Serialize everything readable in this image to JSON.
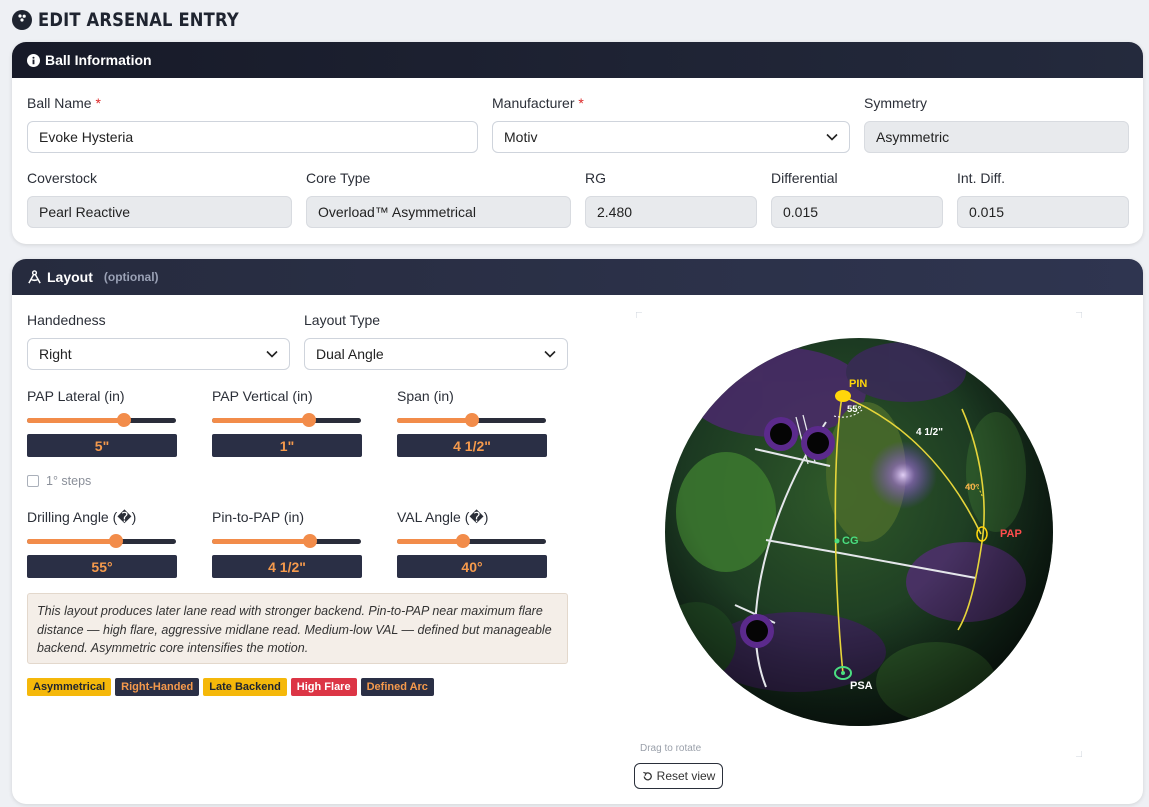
{
  "page": {
    "title": "EDIT ARSENAL ENTRY"
  },
  "ball_info": {
    "heading": "Ball Information",
    "ball_name": {
      "label": "Ball Name",
      "required_mark": "*",
      "value": "Evoke Hysteria"
    },
    "manufacturer": {
      "label": "Manufacturer",
      "required_mark": "*",
      "value": "Motiv"
    },
    "symmetry": {
      "label": "Symmetry",
      "value": "Asymmetric"
    },
    "coverstock": {
      "label": "Coverstock",
      "value": "Pearl Reactive"
    },
    "core_type": {
      "label": "Core Type",
      "value": "Overload™ Asymmetrical"
    },
    "rg": {
      "label": "RG",
      "value": "2.480"
    },
    "differential": {
      "label": "Differential",
      "value": "0.015"
    },
    "int_diff": {
      "label": "Int. Diff.",
      "value": "0.015"
    }
  },
  "layout": {
    "heading": "Layout",
    "optional": "(optional)",
    "handedness": {
      "label": "Handedness",
      "value": "Right"
    },
    "layout_type": {
      "label": "Layout Type",
      "value": "Dual Angle"
    },
    "pap_lateral": {
      "label": "PAP Lateral (in)",
      "display": "5\"",
      "fraction": 0.65
    },
    "pap_vertical": {
      "label": "PAP Vertical (in)",
      "display": "1\"",
      "fraction": 0.65
    },
    "span": {
      "label": "Span (in)",
      "display": "4 1/2\"",
      "fraction": 0.5
    },
    "steps": {
      "label": "1° steps",
      "checked": false
    },
    "drilling_angle": {
      "label": "Drilling Angle (�)",
      "display": "55°",
      "fraction": 0.6
    },
    "pin_to_pap": {
      "label": "Pin-to-PAP (in)",
      "display": "4 1/2\"",
      "fraction": 0.66
    },
    "val_angle": {
      "label": "VAL Angle (�)",
      "display": "40°",
      "fraction": 0.44
    },
    "description": "This layout produces later lane read with stronger backend. Pin-to-PAP near maximum flare distance — high flare, aggressive midlane read. Medium-low VAL — defined but manageable backend. Asymmetric core intensifies the motion.",
    "badges": [
      {
        "text": "Asymmetrical",
        "style": "yellow"
      },
      {
        "text": "Right-Handed",
        "style": "dark"
      },
      {
        "text": "Late Backend",
        "style": "yellow"
      },
      {
        "text": "High Flare",
        "style": "red"
      },
      {
        "text": "Defined Arc",
        "style": "dark"
      }
    ]
  },
  "viz": {
    "pin_label": "PIN",
    "pin_angle": "55°",
    "span_label": "4 1/2\"",
    "val_angle": "40°",
    "pap_label": "PAP",
    "cg_label": "CG",
    "psa_label": "PSA",
    "drag_hint": "Drag to rotate",
    "reset_label": "Reset view"
  },
  "colors": {
    "accent": "#f28c4a",
    "header_dark": "#1a1d2b",
    "required": "#dc2626",
    "pin": "#ffd60a",
    "pap": "#ff4d4d",
    "cg": "#4ade80"
  }
}
